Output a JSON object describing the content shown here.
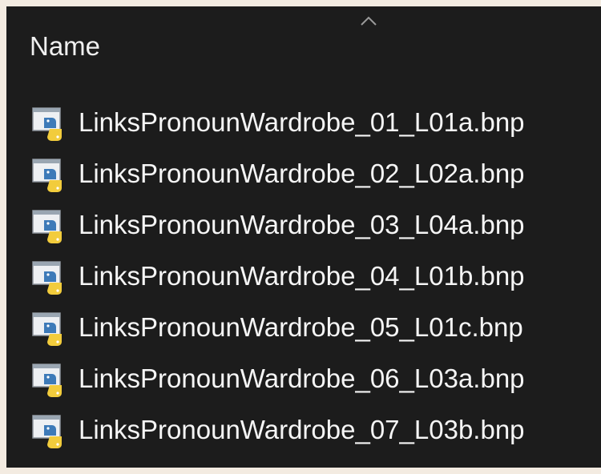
{
  "header": {
    "column_name": "Name",
    "sort_icon": "chevron-up-icon"
  },
  "files": [
    {
      "name": "LinksPronounWardrobe_01_L01a.bnp",
      "icon": "python-file-icon"
    },
    {
      "name": "LinksPronounWardrobe_02_L02a.bnp",
      "icon": "python-file-icon"
    },
    {
      "name": "LinksPronounWardrobe_03_L04a.bnp",
      "icon": "python-file-icon"
    },
    {
      "name": "LinksPronounWardrobe_04_L01b.bnp",
      "icon": "python-file-icon"
    },
    {
      "name": "LinksPronounWardrobe_05_L01c.bnp",
      "icon": "python-file-icon"
    },
    {
      "name": "LinksPronounWardrobe_06_L03a.bnp",
      "icon": "python-file-icon"
    },
    {
      "name": "LinksPronounWardrobe_07_L03b.bnp",
      "icon": "python-file-icon"
    }
  ],
  "colors": {
    "background": "#1c1c1c",
    "text": "#f5f5f5",
    "python_blue": "#3d7ab8",
    "python_yellow": "#f2cc3c"
  }
}
